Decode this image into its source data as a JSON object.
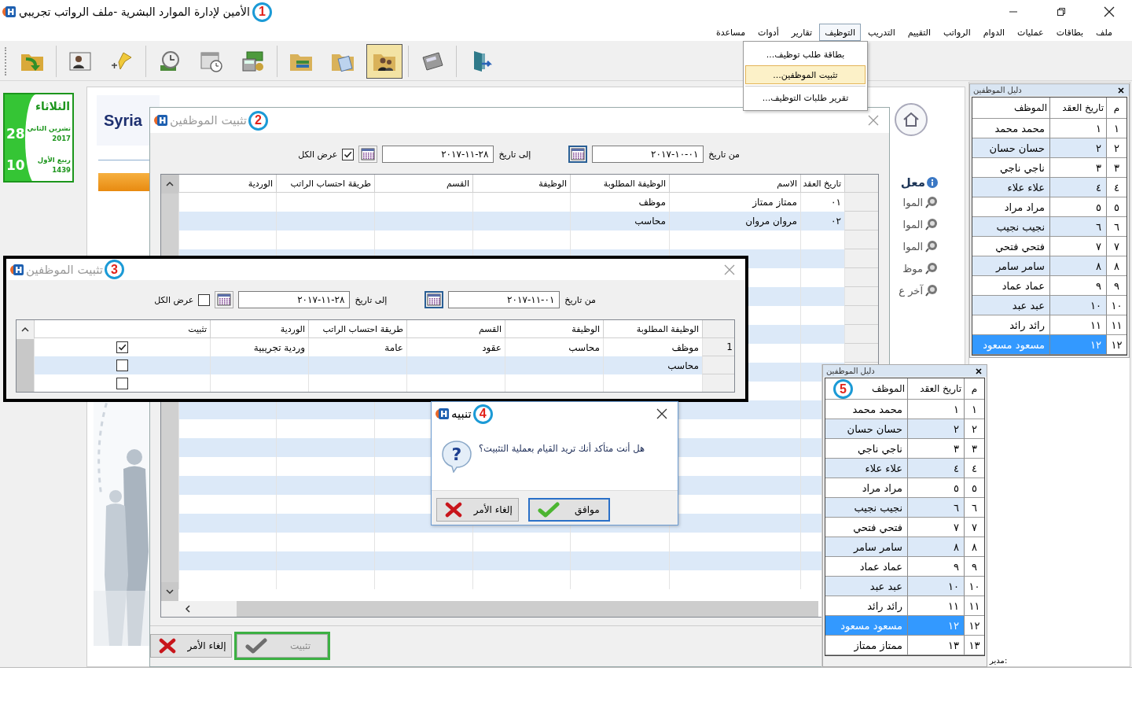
{
  "window": {
    "title": "الأمين لإدارة الموارد البشرية -ملف الرواتب تجريبي",
    "callout": "1"
  },
  "menu": [
    {
      "label": "ملف",
      "selected": false
    },
    {
      "label": "بطاقات",
      "selected": false
    },
    {
      "label": "عمليات",
      "selected": false
    },
    {
      "label": "الدوام",
      "selected": false
    },
    {
      "label": "الرواتب",
      "selected": false
    },
    {
      "label": "التقييم",
      "selected": false
    },
    {
      "label": "التدريب",
      "selected": false
    },
    {
      "label": "التوظيف",
      "selected": true
    },
    {
      "label": "تقارير",
      "selected": false
    },
    {
      "label": "أدوات",
      "selected": false
    },
    {
      "label": "مساعدة",
      "selected": false
    }
  ],
  "dropdown": [
    [
      {
        "label": "بطاقة طلب توظيف...",
        "selected": false
      },
      {
        "label": "تثبيت الموظفين...",
        "selected": true
      }
    ],
    [
      {
        "label": "تقرير طلبات التوظيف...",
        "selected": false
      }
    ]
  ],
  "toolbar": [
    [
      {
        "kind": "folder-arrow",
        "selected": false
      }
    ],
    [
      {
        "kind": "id-card",
        "selected": false
      },
      {
        "kind": "pin",
        "selected": false
      }
    ],
    [
      {
        "kind": "clock",
        "selected": false
      },
      {
        "kind": "calendar-clock",
        "selected": false
      },
      {
        "kind": "money",
        "selected": false
      }
    ],
    [
      {
        "kind": "folder-books",
        "selected": false
      },
      {
        "kind": "folder-paper",
        "selected": false
      },
      {
        "kind": "folder-people",
        "selected": true
      }
    ],
    [
      {
        "kind": "calculator",
        "selected": false
      }
    ],
    [
      {
        "kind": "exit-door",
        "selected": false
      }
    ]
  ],
  "calendar": {
    "weekday": "الثلاثاء",
    "day": "28",
    "month": "تشرين الثاني",
    "year": "2017",
    "hijri_day": "10",
    "hijri_month": "ربيع الأول",
    "hijri_year": "1439"
  },
  "background": {
    "brand": "Syria",
    "heading": "معل",
    "links": [
      "الموا",
      "الموا",
      "الموا",
      "موظ",
      "آخر ع"
    ]
  },
  "directory": {
    "title": "دليل الموظفين",
    "columns": [
      "م",
      "تاريخ العقد",
      "الموظف"
    ],
    "rows": [
      {
        "cells": [
          "١",
          "١",
          "محمد محمد"
        ],
        "selected": false
      },
      {
        "cells": [
          "٢",
          "٢",
          "حسان حسان"
        ],
        "selected": false
      },
      {
        "cells": [
          "٣",
          "٣",
          "ناجي ناجي"
        ],
        "selected": false
      },
      {
        "cells": [
          "٤",
          "٤",
          "علاء علاء"
        ],
        "selected": false
      },
      {
        "cells": [
          "٥",
          "٥",
          "مراد مراد"
        ],
        "selected": false
      },
      {
        "cells": [
          "٦",
          "٦",
          "نجيب نجيب"
        ],
        "selected": false
      },
      {
        "cells": [
          "٧",
          "٧",
          "فتحي فتحي"
        ],
        "selected": false
      },
      {
        "cells": [
          "٨",
          "٨",
          "سامر سامر"
        ],
        "selected": false
      },
      {
        "cells": [
          "٩",
          "٩",
          "عماد عماد"
        ],
        "selected": false
      },
      {
        "cells": [
          "١٠",
          "١٠",
          "عبد عبد"
        ],
        "selected": false
      },
      {
        "cells": [
          "١١",
          "١١",
          "رائد رائد"
        ],
        "selected": false
      },
      {
        "cells": [
          "١٢",
          "١٢",
          "مسعود مسعود"
        ],
        "selected": true
      }
    ]
  },
  "status_bar": {
    "label": "مدير:"
  },
  "hire_dialog": {
    "title": "تثبيت الموظفين",
    "callout": "2",
    "from_label": "من تاريخ",
    "from_value": "٠١-١٠-٢٠١٧",
    "to_label": "إلى تاريخ",
    "to_value": "٢٨-١١-٢٠١٧",
    "show_all_label": "عرض الكل",
    "show_all_checked": true,
    "columns": [
      "تاريخ العقد",
      "الاسم",
      "الوظيفة المطلوبة",
      "الوظيفة",
      "القسم",
      "طريقة احتساب الراتب",
      "الوردية"
    ],
    "rows": [
      {
        "cells": [
          "٠١",
          "ممتاز ممتاز",
          "موظف"
        ]
      },
      {
        "cells": [
          "٠٢",
          "مروان مروان",
          "محاسب"
        ]
      }
    ],
    "buttons": [
      {
        "kind": "confirm",
        "label": "تثبيت",
        "disabled": true,
        "highlighted": true
      },
      {
        "kind": "cancel",
        "label": "إلغاء الأمر",
        "disabled": false,
        "highlighted": false
      }
    ]
  },
  "confirm_dialog": {
    "title": "تثبيت الموظفين",
    "callout": "3",
    "from_label": "من تاريخ",
    "from_value": "٠١-١١-٢٠١٧",
    "to_label": "إلى تاريخ",
    "to_value": "٢٨-١١-٢٠١٧",
    "show_all_label": "عرض الكل",
    "show_all_checked": false,
    "columns": [
      "الوظيفة المطلوبة",
      "الوظيفة",
      "القسم",
      "طريقة احتساب الراتب",
      "الوردية",
      "تثبيت"
    ],
    "rows": [
      {
        "number": "1",
        "cells": [
          "موظف",
          "محاسب",
          "عقود",
          "عامة",
          "وردية تجريبية"
        ],
        "checked": true
      },
      {
        "cells": [
          "محاسب"
        ],
        "checked": false
      },
      {
        "checked": false
      }
    ]
  },
  "alert": {
    "title": "تنبيه",
    "callout": "4",
    "message": "هل أنت متأكد أنك تريد القيام بعملية التثبيت؟",
    "icon_glyph": "?",
    "buttons": [
      {
        "kind": "ok",
        "label": "موافق",
        "default": true
      },
      {
        "kind": "cancel",
        "label": "إلغاء الأمر",
        "default": false
      }
    ]
  },
  "directory_popup": {
    "title": "دليل الموظفين",
    "callout": "5",
    "columns": [
      "م",
      "تاريخ العقد",
      "الموظف"
    ],
    "rows": [
      {
        "cells": [
          "١",
          "١",
          "محمد محمد"
        ],
        "selected": false
      },
      {
        "cells": [
          "٢",
          "٢",
          "حسان حسان"
        ],
        "selected": false
      },
      {
        "cells": [
          "٣",
          "٣",
          "ناجي ناجي"
        ],
        "selected": false
      },
      {
        "cells": [
          "٤",
          "٤",
          "علاء علاء"
        ],
        "selected": false
      },
      {
        "cells": [
          "٥",
          "٥",
          "مراد مراد"
        ],
        "selected": false
      },
      {
        "cells": [
          "٦",
          "٦",
          "نجيب نجيب"
        ],
        "selected": false
      },
      {
        "cells": [
          "٧",
          "٧",
          "فتحي فتحي"
        ],
        "selected": false
      },
      {
        "cells": [
          "٨",
          "٨",
          "سامر سامر"
        ],
        "selected": false
      },
      {
        "cells": [
          "٩",
          "٩",
          "عماد عماد"
        ],
        "selected": false
      },
      {
        "cells": [
          "١٠",
          "١٠",
          "عبد عبد"
        ],
        "selected": false
      },
      {
        "cells": [
          "١١",
          "١١",
          "رائد رائد"
        ],
        "selected": false
      },
      {
        "cells": [
          "١٢",
          "١٢",
          "مسعود مسعود"
        ],
        "selected": true
      },
      {
        "cells": [
          "١٣",
          "١٣",
          "ممتاز ممتاز"
        ],
        "selected": false
      }
    ]
  }
}
